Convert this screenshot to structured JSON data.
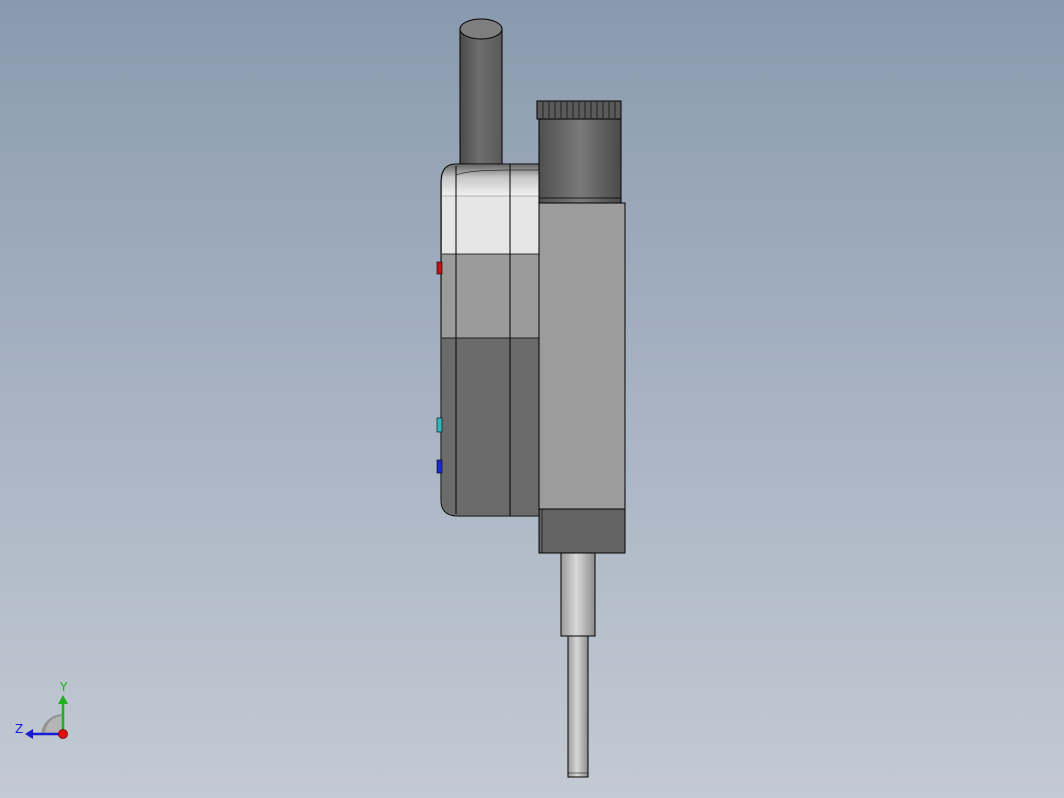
{
  "view": {
    "background_top": "#8a9aae",
    "background_bottom": "#c3cad3"
  },
  "model": {
    "part_icon": "dial-indicator-side-view",
    "body_color": "#9c9c9c",
    "edge_color": "#000000"
  },
  "triad": {
    "y_label": "Y",
    "z_label": "Z",
    "y_color": "#1db11d",
    "z_color": "#1a1ad0",
    "x_color": "#e01010"
  }
}
